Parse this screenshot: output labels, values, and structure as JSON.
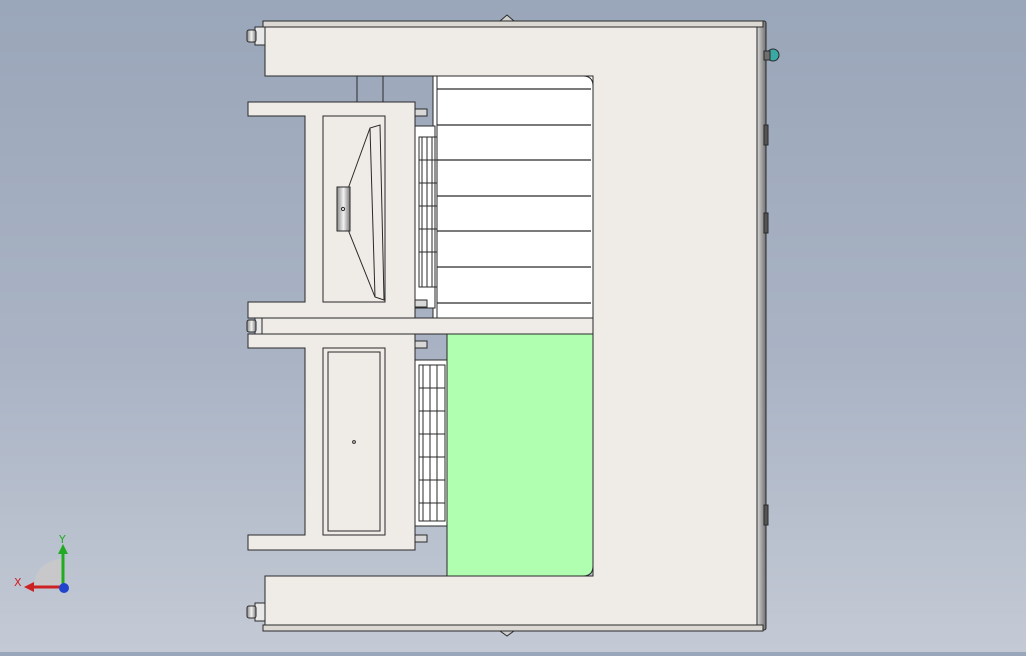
{
  "viewport": {
    "background_top": "#9aa6b9",
    "background_bottom": "#c4cad5"
  },
  "model": {
    "frame_color": "#efebe7",
    "edge_color": "#2a2a2a",
    "highlight_color": "#b0ffb0",
    "knob_color": "#3aa9a4"
  },
  "triad": {
    "x_label": "X",
    "y_label": "Y",
    "x_color": "#cc2222",
    "y_color": "#22aa22",
    "z_color": "#2244cc"
  }
}
